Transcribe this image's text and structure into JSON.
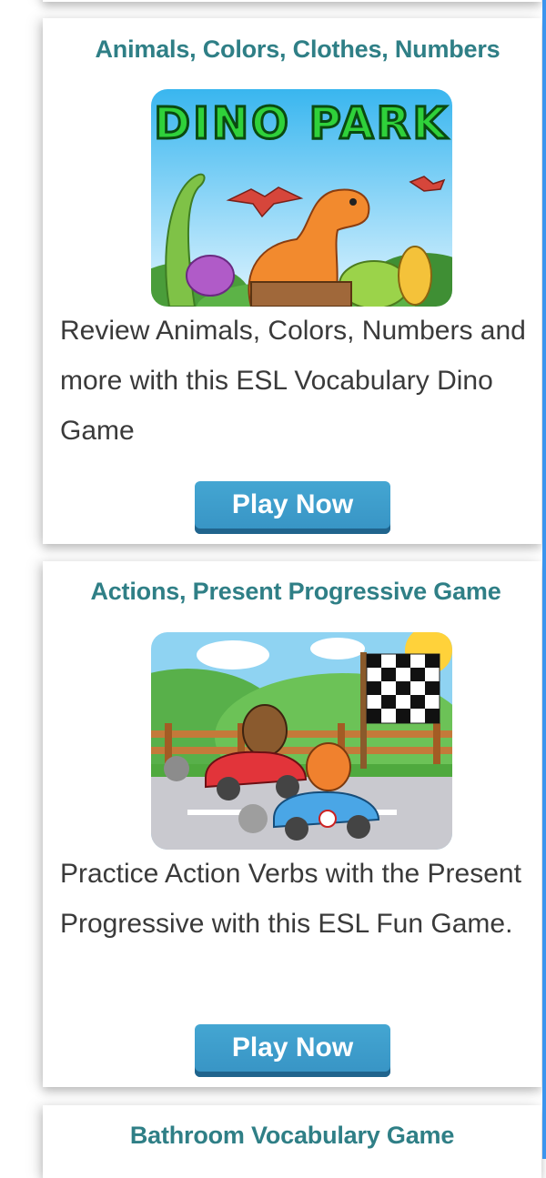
{
  "cards": [
    {
      "title": "Animals, Colors, Clothes, Numbers",
      "image_banner": "DINO PARK",
      "description": "Review Animals, Colors, Numbers and more with this ESL Vocabulary Dino Game",
      "button_label": "Play Now"
    },
    {
      "title": "Actions, Present Progressive Game",
      "description": "Practice Action Verbs with the Present Progressive with this ESL Fun Game.",
      "button_label": "Play Now"
    },
    {
      "title": "Bathroom Vocabulary Game"
    }
  ],
  "colors": {
    "title": "#2f7f86",
    "button": "#3a97c8",
    "button_shadow": "#20648d",
    "accent_bar": "#3c95ee"
  }
}
